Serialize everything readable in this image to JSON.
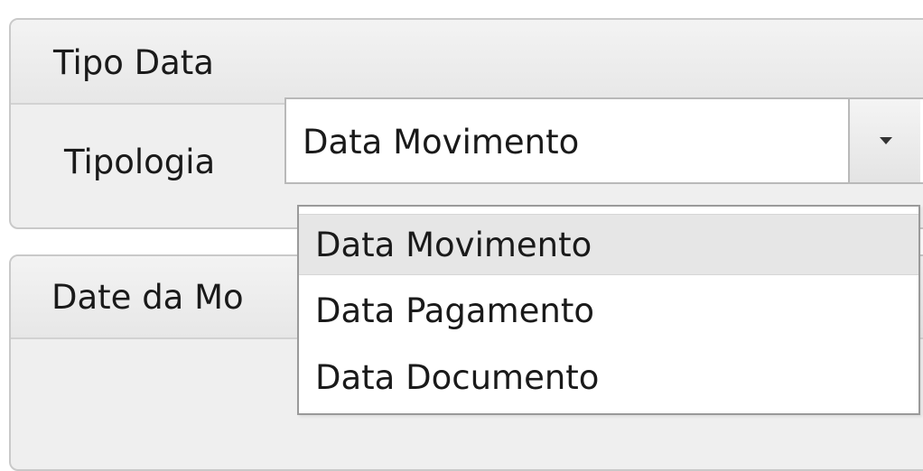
{
  "tipo_data_group": {
    "title": "Tipo Data",
    "field_label": "Tipologia",
    "combo": {
      "selected_value": "Data Movimento"
    }
  },
  "date_group": {
    "title_visible": "Date da Mo"
  },
  "dropdown": {
    "items": [
      {
        "label": "Data Movimento",
        "selected": true
      },
      {
        "label": "Data Pagamento",
        "selected": false
      },
      {
        "label": "Data Documento",
        "selected": false
      }
    ]
  },
  "icons": {
    "combo_arrow": "chevron-down-icon"
  }
}
